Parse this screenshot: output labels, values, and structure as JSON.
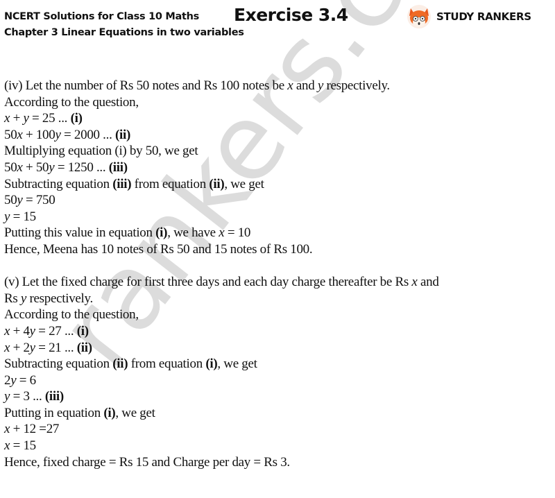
{
  "header": {
    "title": "NCERT Solutions for Class 10 Maths",
    "chapter": "Chapter 3 Linear Equations in two variables",
    "exercise": "Exercise 3.4",
    "brand_name": "STUDY RANKERS",
    "brand_icon": "fox-mascot-icon"
  },
  "watermark": "rankers.com",
  "part_iv": {
    "lines": [
      [
        {
          "t": "(iv) Let the number of Rs 50 notes and Rs 100 notes be "
        },
        {
          "t": "x",
          "i": true
        },
        {
          "t": " and "
        },
        {
          "t": "y",
          "i": true
        },
        {
          "t": " respectively."
        }
      ],
      [
        {
          "t": "According to the question,"
        }
      ],
      [
        {
          "t": "x",
          "i": true
        },
        {
          "t": " + "
        },
        {
          "t": "y",
          "i": true
        },
        {
          "t": " = 25 ... "
        },
        {
          "t": "(i)",
          "b": true
        }
      ],
      [
        {
          "t": "50"
        },
        {
          "t": "x",
          "i": true
        },
        {
          "t": " + 100"
        },
        {
          "t": "y",
          "i": true
        },
        {
          "t": " = 2000 ... "
        },
        {
          "t": "(ii)",
          "b": true
        }
      ],
      [
        {
          "t": "Multiplying equation (i) by 50, we get"
        }
      ],
      [
        {
          "t": "50"
        },
        {
          "t": "x",
          "i": true
        },
        {
          "t": " + 50"
        },
        {
          "t": "y",
          "i": true
        },
        {
          "t": " = 1250 ... "
        },
        {
          "t": "(iii)",
          "b": true
        }
      ],
      [
        {
          "t": "Subtracting equation "
        },
        {
          "t": "(iii)",
          "b": true
        },
        {
          "t": " from equation "
        },
        {
          "t": "(ii)",
          "b": true
        },
        {
          "t": ", we get"
        }
      ],
      [
        {
          "t": "50"
        },
        {
          "t": "y",
          "i": true
        },
        {
          "t": " = 750"
        }
      ],
      [
        {
          "t": "y",
          "i": true
        },
        {
          "t": " = 15"
        }
      ],
      [
        {
          "t": "Putting this value in equation "
        },
        {
          "t": "(i)",
          "b": true
        },
        {
          "t": ", we have "
        },
        {
          "t": "x",
          "i": true
        },
        {
          "t": " = 10"
        }
      ],
      [
        {
          "t": "Hence, Meena has 10 notes of Rs 50 and 15 notes of Rs 100."
        }
      ]
    ]
  },
  "part_v": {
    "lines": [
      [
        {
          "t": "(v) Let the fixed charge for first three days and each day charge thereafter be Rs "
        },
        {
          "t": "x",
          "i": true
        },
        {
          "t": " and"
        }
      ],
      [
        {
          "t": "Rs "
        },
        {
          "t": "y",
          "i": true
        },
        {
          "t": " respectively."
        }
      ],
      [
        {
          "t": "According to the question,"
        }
      ],
      [
        {
          "t": "x",
          "i": true
        },
        {
          "t": " + 4"
        },
        {
          "t": "y",
          "i": true
        },
        {
          "t": " = 27 ... "
        },
        {
          "t": "(i)",
          "b": true
        }
      ],
      [
        {
          "t": "x",
          "i": true
        },
        {
          "t": " + 2"
        },
        {
          "t": "y",
          "i": true
        },
        {
          "t": " = 21 ... "
        },
        {
          "t": "(ii)",
          "b": true
        }
      ],
      [
        {
          "t": "Subtracting equation "
        },
        {
          "t": "(ii)",
          "b": true
        },
        {
          "t": " from equation "
        },
        {
          "t": "(i)",
          "b": true
        },
        {
          "t": ", we get"
        }
      ],
      [
        {
          "t": "2"
        },
        {
          "t": "y",
          "i": true
        },
        {
          "t": " = 6"
        }
      ],
      [
        {
          "t": "y",
          "i": true
        },
        {
          "t": " = 3 ... "
        },
        {
          "t": "(iii)",
          "b": true
        }
      ],
      [
        {
          "t": "Putting in equation "
        },
        {
          "t": "(i)",
          "b": true
        },
        {
          "t": ", we get"
        }
      ],
      [
        {
          "t": "x",
          "i": true
        },
        {
          "t": " + 12 =27"
        }
      ],
      [
        {
          "t": "x",
          "i": true
        },
        {
          "t": " = 15"
        }
      ],
      [
        {
          "t": "Hence, fixed charge = Rs 15 and Charge per day = Rs 3."
        }
      ]
    ]
  }
}
